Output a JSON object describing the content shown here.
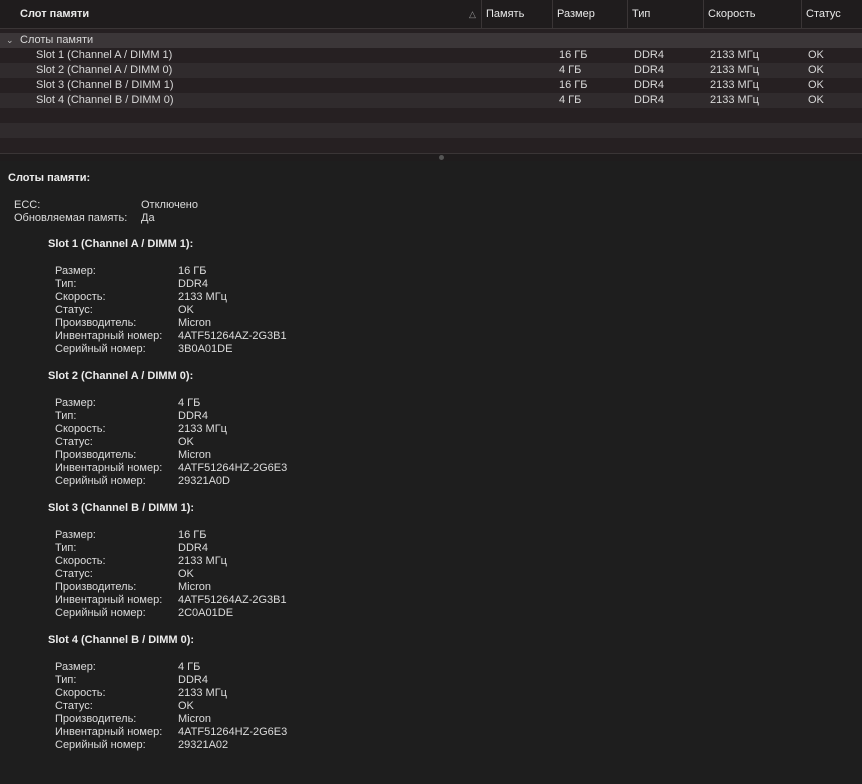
{
  "table": {
    "columns": [
      "Слот памяти",
      "Память",
      "Размер",
      "Тип",
      "Скорость",
      "Статус"
    ],
    "group_label": "Слоты памяти",
    "rows": [
      {
        "name": "Slot 1 (Channel A / DIMM 1)",
        "size": "16 ГБ",
        "type": "DDR4",
        "speed": "2133 МГц",
        "status": "OK"
      },
      {
        "name": "Slot 2 (Channel A / DIMM 0)",
        "size": "4 ГБ",
        "type": "DDR4",
        "speed": "2133 МГц",
        "status": "OK"
      },
      {
        "name": "Slot 3 (Channel B / DIMM 1)",
        "size": "16 ГБ",
        "type": "DDR4",
        "speed": "2133 МГц",
        "status": "OK"
      },
      {
        "name": "Slot 4 (Channel B / DIMM 0)",
        "size": "4 ГБ",
        "type": "DDR4",
        "speed": "2133 МГц",
        "status": "OK"
      }
    ]
  },
  "detail": {
    "title": "Слоты памяти:",
    "general": [
      {
        "label": "ECC:",
        "value": "Отключено"
      },
      {
        "label": "Обновляемая память:",
        "value": "Да"
      }
    ],
    "slots": [
      {
        "title": "Slot 1 (Channel A / DIMM 1):",
        "fields": [
          {
            "label": "Размер:",
            "value": "16 ГБ"
          },
          {
            "label": "Тип:",
            "value": "DDR4"
          },
          {
            "label": "Скорость:",
            "value": "2133 МГц"
          },
          {
            "label": "Статус:",
            "value": "OK"
          },
          {
            "label": "Производитель:",
            "value": "Micron"
          },
          {
            "label": "Инвентарный номер:",
            "value": "4ATF51264AZ-2G3B1"
          },
          {
            "label": "Серийный номер:",
            "value": "3B0A01DE"
          }
        ]
      },
      {
        "title": "Slot 2 (Channel A / DIMM 0):",
        "fields": [
          {
            "label": "Размер:",
            "value": "4 ГБ"
          },
          {
            "label": "Тип:",
            "value": "DDR4"
          },
          {
            "label": "Скорость:",
            "value": "2133 МГц"
          },
          {
            "label": "Статус:",
            "value": "OK"
          },
          {
            "label": "Производитель:",
            "value": "Micron"
          },
          {
            "label": "Инвентарный номер:",
            "value": "4ATF51264HZ-2G6E3"
          },
          {
            "label": "Серийный номер:",
            "value": "29321A0D"
          }
        ]
      },
      {
        "title": "Slot 3 (Channel B / DIMM 1):",
        "fields": [
          {
            "label": "Размер:",
            "value": "16 ГБ"
          },
          {
            "label": "Тип:",
            "value": "DDR4"
          },
          {
            "label": "Скорость:",
            "value": "2133 МГц"
          },
          {
            "label": "Статус:",
            "value": "OK"
          },
          {
            "label": "Производитель:",
            "value": "Micron"
          },
          {
            "label": "Инвентарный номер:",
            "value": "4ATF51264AZ-2G3B1"
          },
          {
            "label": "Серийный номер:",
            "value": "2C0A01DE"
          }
        ]
      },
      {
        "title": "Slot 4 (Channel B / DIMM 0):",
        "fields": [
          {
            "label": "Размер:",
            "value": "4 ГБ"
          },
          {
            "label": "Тип:",
            "value": "DDR4"
          },
          {
            "label": "Скорость:",
            "value": "2133 МГц"
          },
          {
            "label": "Статус:",
            "value": "OK"
          },
          {
            "label": "Производитель:",
            "value": "Micron"
          },
          {
            "label": "Инвентарный номер:",
            "value": "4ATF51264HZ-2G6E3"
          },
          {
            "label": "Серийный номер:",
            "value": "29321A02"
          }
        ]
      }
    ]
  }
}
